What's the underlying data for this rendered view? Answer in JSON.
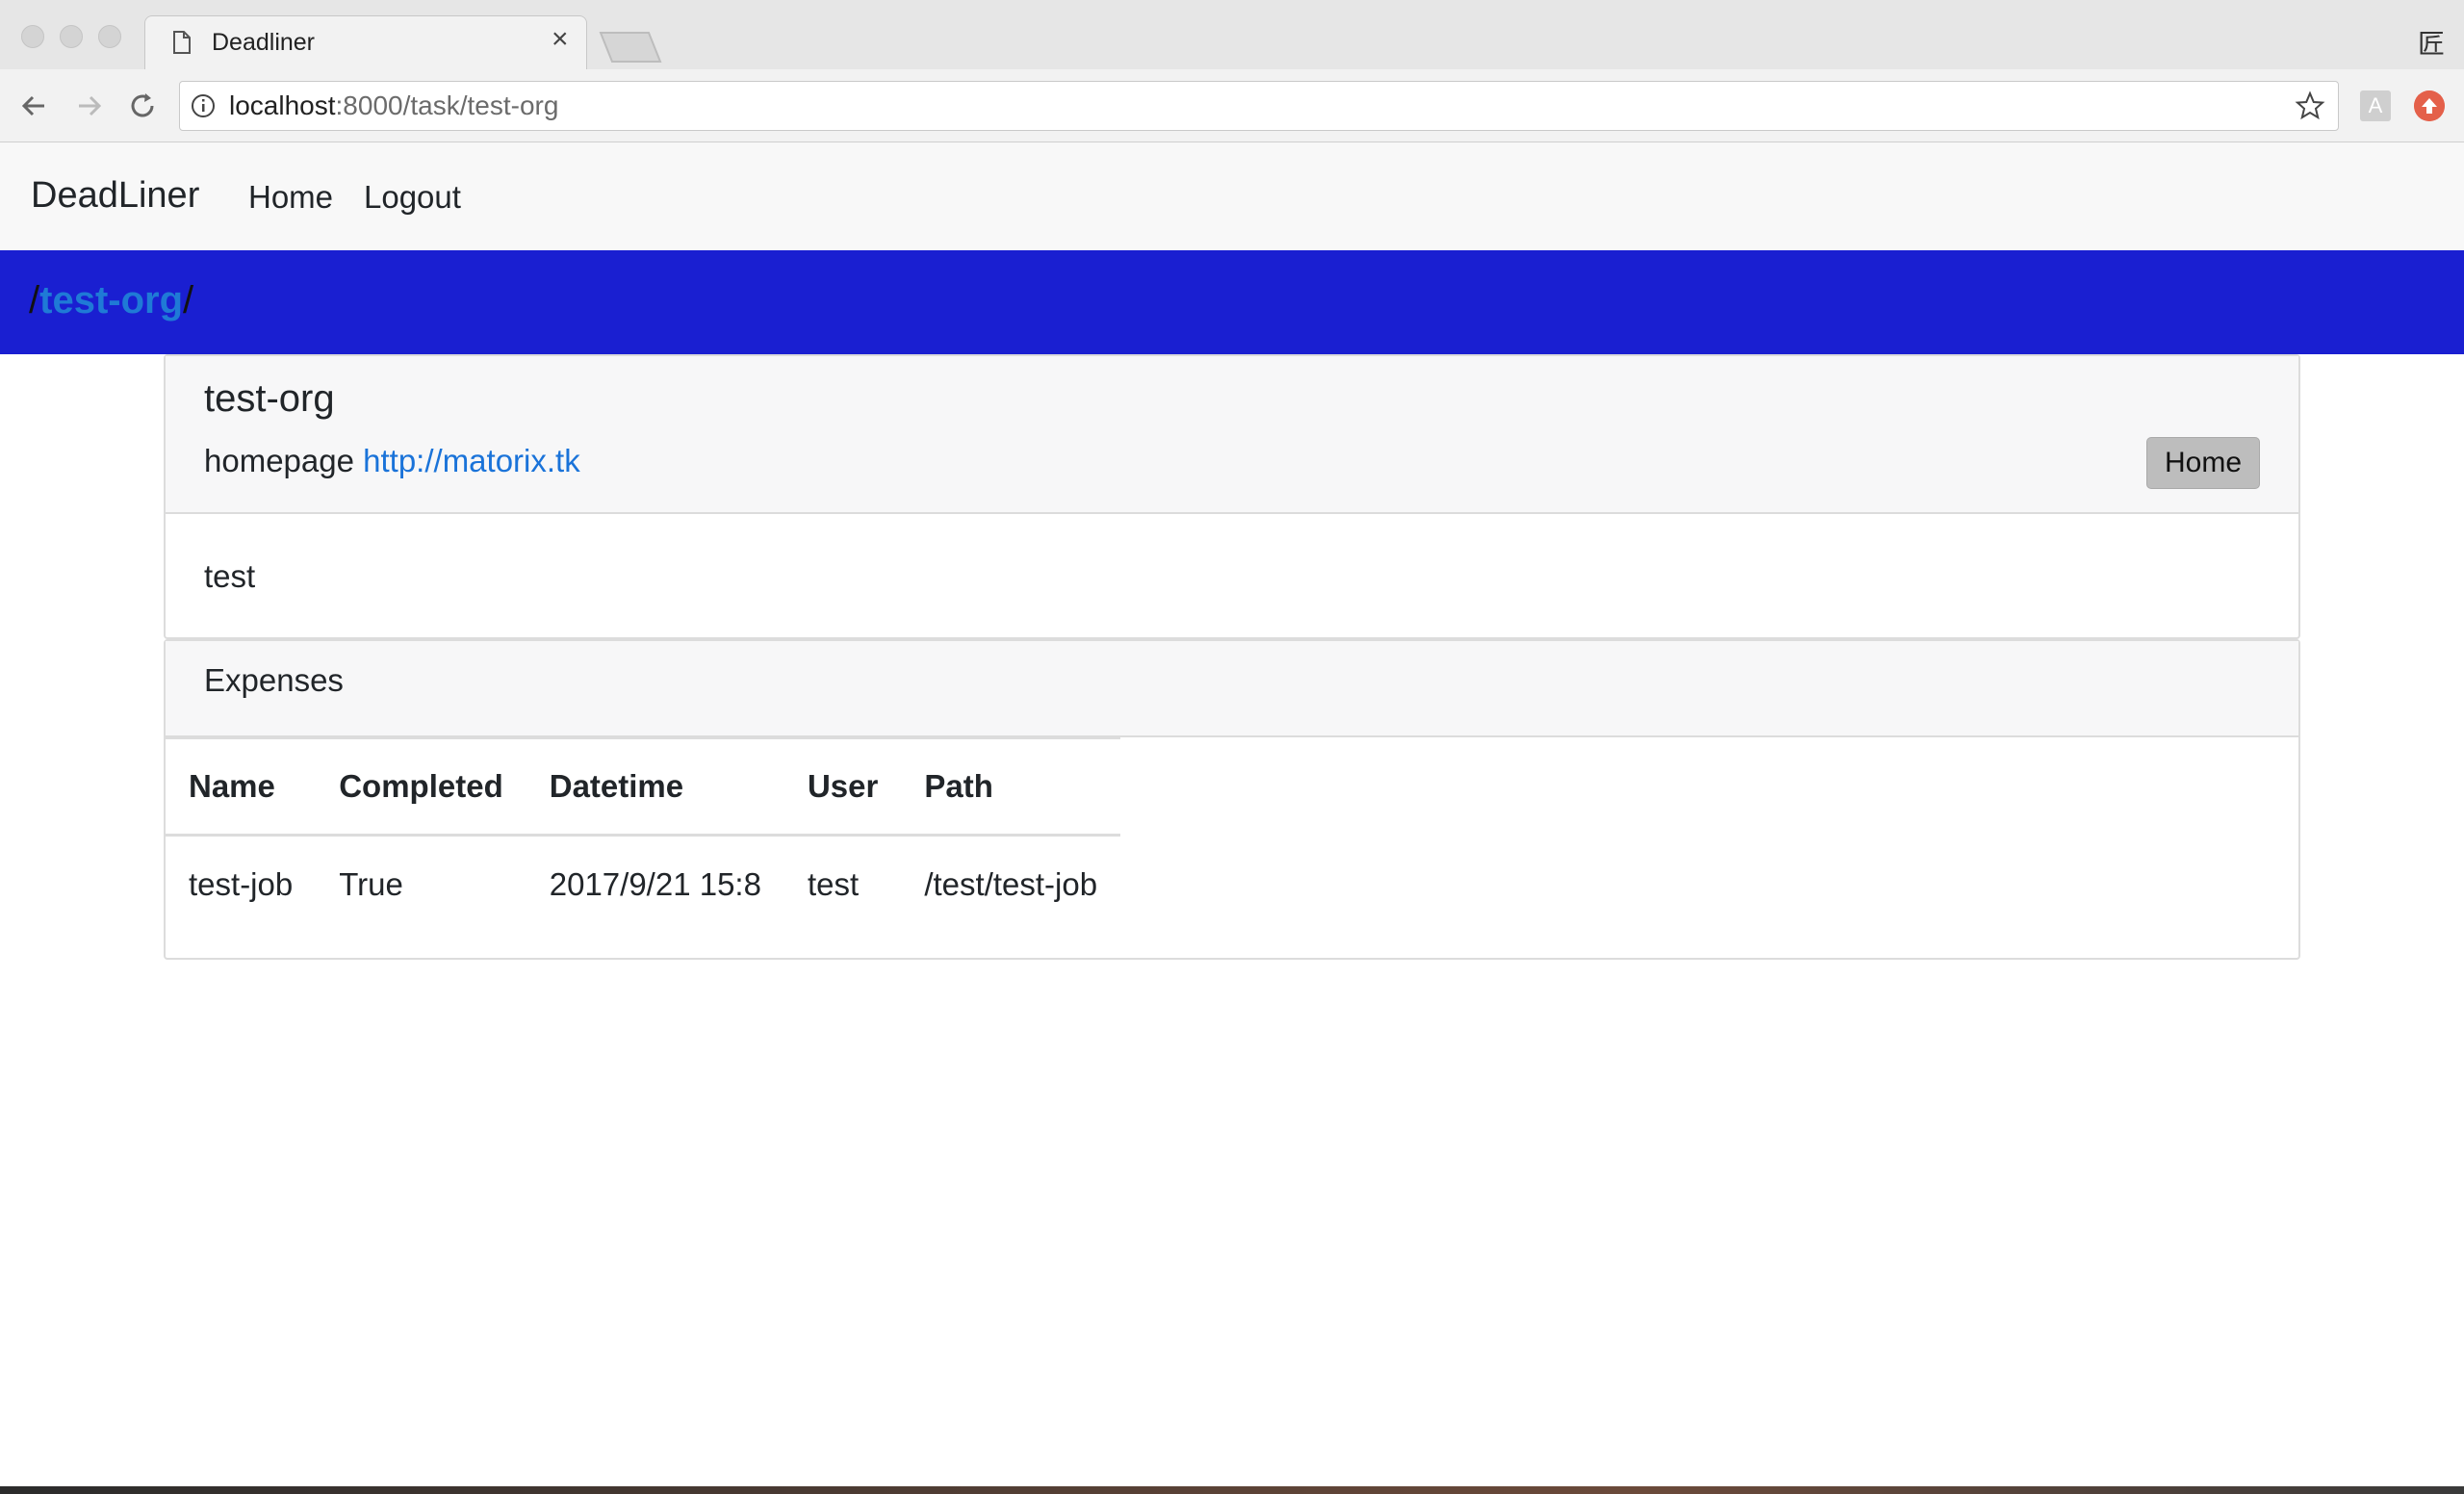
{
  "browser": {
    "tab_title": "Deadliner",
    "tab_close": "×",
    "url_host": "localhost",
    "url_rest": ":8000/task/test-org",
    "top_right_icon": "匠",
    "extension_a": "A"
  },
  "navbar": {
    "brand": "DeadLiner",
    "links": [
      "Home",
      "Logout"
    ]
  },
  "breadcrumb": {
    "prefix": "/",
    "org": "test-org",
    "suffix": "/"
  },
  "org_card": {
    "title": "test-org",
    "homepage_label": "homepage",
    "homepage_url": "http://matorix.tk",
    "home_button": "Home",
    "description": "test"
  },
  "expenses": {
    "title": "Expenses",
    "columns": [
      "Name",
      "Completed",
      "Datetime",
      "User",
      "Path"
    ],
    "rows": [
      [
        "test-job",
        "True",
        "2017/9/21 15:8",
        "test",
        "/test/test-job"
      ]
    ]
  },
  "colors": {
    "breadcrumb_bar": "#1a1fd1",
    "link": "#1a73d9",
    "button": "#bdbdbd"
  },
  "icons": [
    "document-icon",
    "close-icon",
    "back-icon",
    "forward-icon",
    "reload-icon",
    "info-icon",
    "star-icon"
  ]
}
